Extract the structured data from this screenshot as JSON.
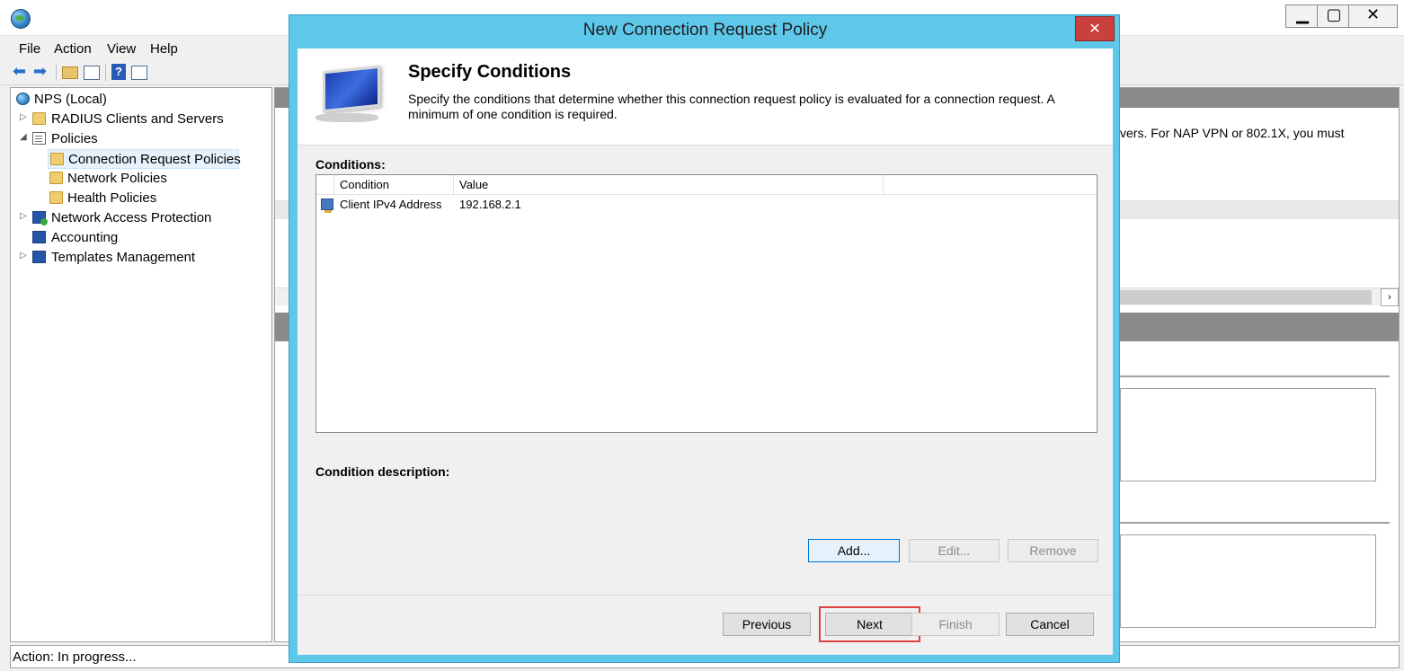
{
  "main_window": {
    "title": "",
    "menu": [
      "File",
      "Action",
      "View",
      "Help"
    ],
    "tree": [
      {
        "label": "NPS (Local)",
        "icon": "globe-icon",
        "expander": ""
      },
      {
        "label": "RADIUS Clients and Servers",
        "icon": "folder-icon",
        "expander": "▷"
      },
      {
        "label": "Policies",
        "icon": "policies-icon",
        "expander": "◢"
      },
      {
        "label": "Connection Request Policies",
        "icon": "folder-icon",
        "expander": "",
        "selected": true
      },
      {
        "label": "Network Policies",
        "icon": "folder-icon",
        "expander": ""
      },
      {
        "label": "Health Policies",
        "icon": "folder-icon",
        "expander": ""
      },
      {
        "label": "Network Access Protection",
        "icon": "nap-icon",
        "expander": "▷"
      },
      {
        "label": "Accounting",
        "icon": "accounting-icon",
        "expander": ""
      },
      {
        "label": "Templates Management",
        "icon": "templates-icon",
        "expander": "▷"
      }
    ],
    "right_pane_text": "vers. For NAP VPN or 802.1X, you must",
    "status": "Action:  In progress..."
  },
  "dialog": {
    "title": "New Connection Request Policy",
    "heading": "Specify Conditions",
    "description": "Specify the conditions that determine whether this connection request policy is evaluated for a connection request. A minimum of one condition is required.",
    "conditions_label": "Conditions:",
    "columns": [
      "Condition",
      "Value"
    ],
    "rows": [
      {
        "condition": "Client IPv4 Address",
        "value": "192.168.2.1"
      }
    ],
    "condition_description_label": "Condition description:",
    "buttons": {
      "add": "Add...",
      "edit": "Edit...",
      "remove": "Remove",
      "previous": "Previous",
      "next": "Next",
      "finish": "Finish",
      "cancel": "Cancel"
    }
  },
  "colors": {
    "dialog_frame": "#5ec8ea",
    "close_button": "#c9413d",
    "highlight": "#e04040"
  }
}
